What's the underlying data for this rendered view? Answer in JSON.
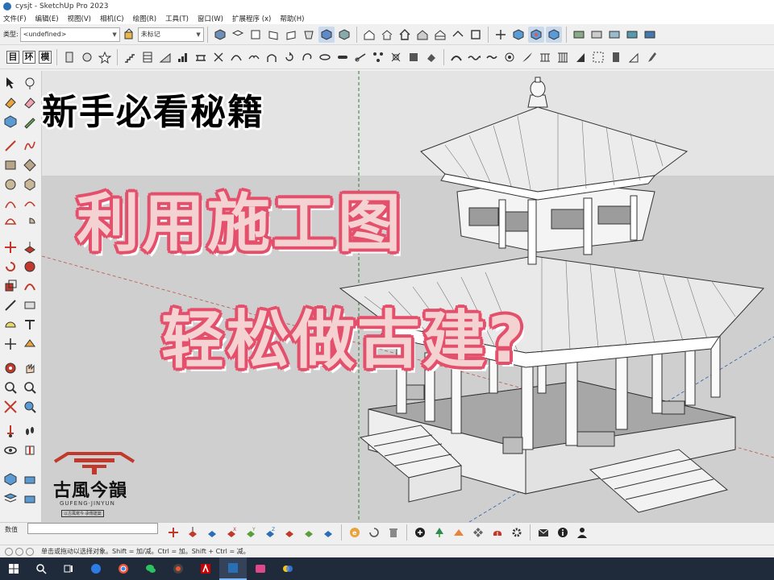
{
  "window": {
    "title": "cysjt - SketchUp Pro 2023"
  },
  "menu": [
    "文件(F)",
    "编辑(E)",
    "视图(V)",
    "相机(C)",
    "绘图(R)",
    "工具(T)",
    "窗口(W)",
    "扩展程序 (x)",
    "帮助(H)"
  ],
  "toolbar": {
    "type_label": "类型:",
    "type_value": "<undefined>",
    "tag_value": "未标记",
    "row2_boxes": [
      "目",
      "环",
      "模"
    ]
  },
  "overlay": {
    "line1": "新手必看秘籍",
    "line2": "利用施工图",
    "line3": "轻松做古建?"
  },
  "logo": {
    "name": "古風今韻",
    "sub": "GUFENG·JINYUN",
    "tag": "以古風寫今·承傳建築"
  },
  "measurements": {
    "label": "数值"
  },
  "status": {
    "hint": "单击或拖动以选择对象。Shift = 加/减。Ctrl = 加。Shift + Ctrl = 减。"
  },
  "colors": {
    "accent_pink": "#e4506c",
    "title_fill": "#f5d2d2",
    "logo_red": "#c0392b",
    "taskbar": "#1f2a3a"
  }
}
